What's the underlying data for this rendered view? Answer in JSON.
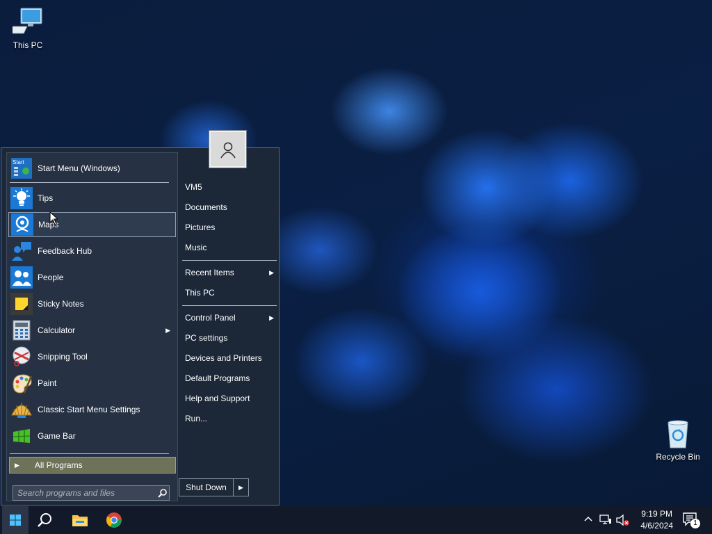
{
  "desktop": {
    "icons": [
      {
        "label": "This PC"
      },
      {
        "label": "Recycle Bin"
      }
    ]
  },
  "start_menu": {
    "header_item": {
      "label": "Start Menu (Windows)",
      "icon": "start-menu-icon"
    },
    "apps": [
      {
        "label": "Tips",
        "icon": "lightbulb-icon"
      },
      {
        "label": "Maps",
        "icon": "maps-icon",
        "state": "hovered"
      },
      {
        "label": "Feedback Hub",
        "icon": "feedback-icon"
      },
      {
        "label": "People",
        "icon": "people-icon"
      },
      {
        "label": "Sticky Notes",
        "icon": "sticky-note-icon"
      },
      {
        "label": "Calculator",
        "icon": "calculator-icon",
        "has_submenu": true
      },
      {
        "label": "Snipping Tool",
        "icon": "scissors-icon"
      },
      {
        "label": "Paint",
        "icon": "paint-palette-icon"
      },
      {
        "label": "Classic Start Menu Settings",
        "icon": "shell-icon"
      },
      {
        "label": "Game Bar",
        "icon": "game-bar-icon"
      }
    ],
    "all_programs": "All Programs",
    "search_placeholder": "Search programs and files",
    "right_items": [
      {
        "label": "VM5"
      },
      {
        "label": "Documents"
      },
      {
        "label": "Pictures"
      },
      {
        "label": "Music"
      },
      {
        "label": "Recent Items",
        "has_submenu": true
      },
      {
        "label": "This PC"
      },
      {
        "label": "Control Panel",
        "has_submenu": true
      },
      {
        "label": "PC settings"
      },
      {
        "label": "Devices and Printers"
      },
      {
        "label": "Default Programs"
      },
      {
        "label": "Help and Support"
      },
      {
        "label": "Run..."
      }
    ],
    "shutdown_label": "Shut Down"
  },
  "taskbar": {
    "time": "9:19 PM",
    "date": "4/6/2024",
    "notification_count": "1"
  },
  "colors": {
    "menu_bg": "#1c2838",
    "left_pane_bg": "#263244",
    "all_programs_bg": "#6e7258",
    "taskbar_bg": "#121a2a"
  }
}
